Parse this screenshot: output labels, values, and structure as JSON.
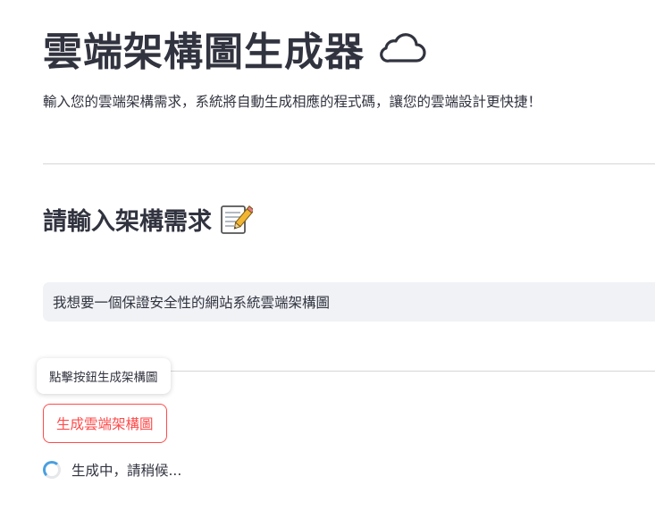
{
  "header": {
    "title": "雲端架構圖生成器",
    "title_icon": "cloud-icon",
    "subtitle": "輸入您的雲端架構需求，系統將自動生成相應的程式碼，讓您的雲端設計更快捷！"
  },
  "section": {
    "title": "請輸入架構需求",
    "title_icon": "memo-icon"
  },
  "input": {
    "value": "我想要一個保證安全性的網站系統雲端架構圖"
  },
  "tooltip": {
    "text": "點擊按鈕生成架構圖"
  },
  "button": {
    "label": "生成雲端架構圖"
  },
  "status": {
    "text": "生成中，請稍候..."
  },
  "colors": {
    "accent": "#ff4b4b",
    "text": "#31333f",
    "input_bg": "#f0f2f6",
    "spinner": "#4a9fe0"
  }
}
